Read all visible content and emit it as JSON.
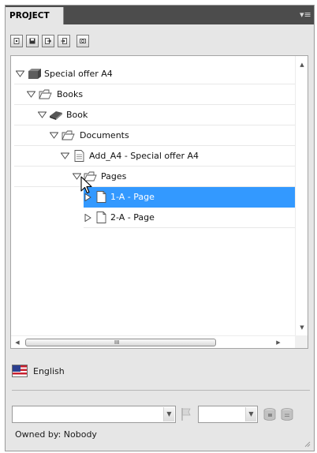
{
  "panel": {
    "tab_label": "PROJECT",
    "menu_icon": "panel-menu-icon"
  },
  "toolbar": {
    "buttons": [
      {
        "name": "new-document-button",
        "icon": "new-document-icon"
      },
      {
        "name": "save-button",
        "icon": "save-icon"
      },
      {
        "name": "export-button",
        "icon": "export-icon"
      },
      {
        "name": "import-button",
        "icon": "import-icon"
      },
      {
        "name": "refresh-button",
        "icon": "refresh-icon"
      }
    ]
  },
  "tree": {
    "rows": [
      {
        "label": "Special offer A4",
        "icon": "project-box-icon",
        "expanded": true,
        "selected": false
      },
      {
        "label": "Books",
        "icon": "folder-icon",
        "expanded": true,
        "selected": false
      },
      {
        "label": "Book",
        "icon": "book-icon",
        "expanded": true,
        "selected": false
      },
      {
        "label": "Documents",
        "icon": "folder-icon",
        "expanded": true,
        "selected": false
      },
      {
        "label": "Add_A4 - Special offer A4",
        "icon": "document-icon",
        "expanded": true,
        "selected": false
      },
      {
        "label": "Pages",
        "icon": "folder-icon",
        "expanded": true,
        "selected": false
      },
      {
        "label": "1-A - Page",
        "icon": "page-icon",
        "expanded": false,
        "selected": true
      },
      {
        "label": "2-A - Page",
        "icon": "page-icon",
        "expanded": false,
        "selected": false
      }
    ],
    "hscroll_grip": "III"
  },
  "language": {
    "label": "English",
    "flag_icon": "us-flag-icon"
  },
  "footer": {
    "owner_text": "Owned by: Nobody"
  },
  "colors": {
    "selection": "#3399ff",
    "tab_bar": "#4c4c4c",
    "panel_bg": "#e6e6e6"
  }
}
